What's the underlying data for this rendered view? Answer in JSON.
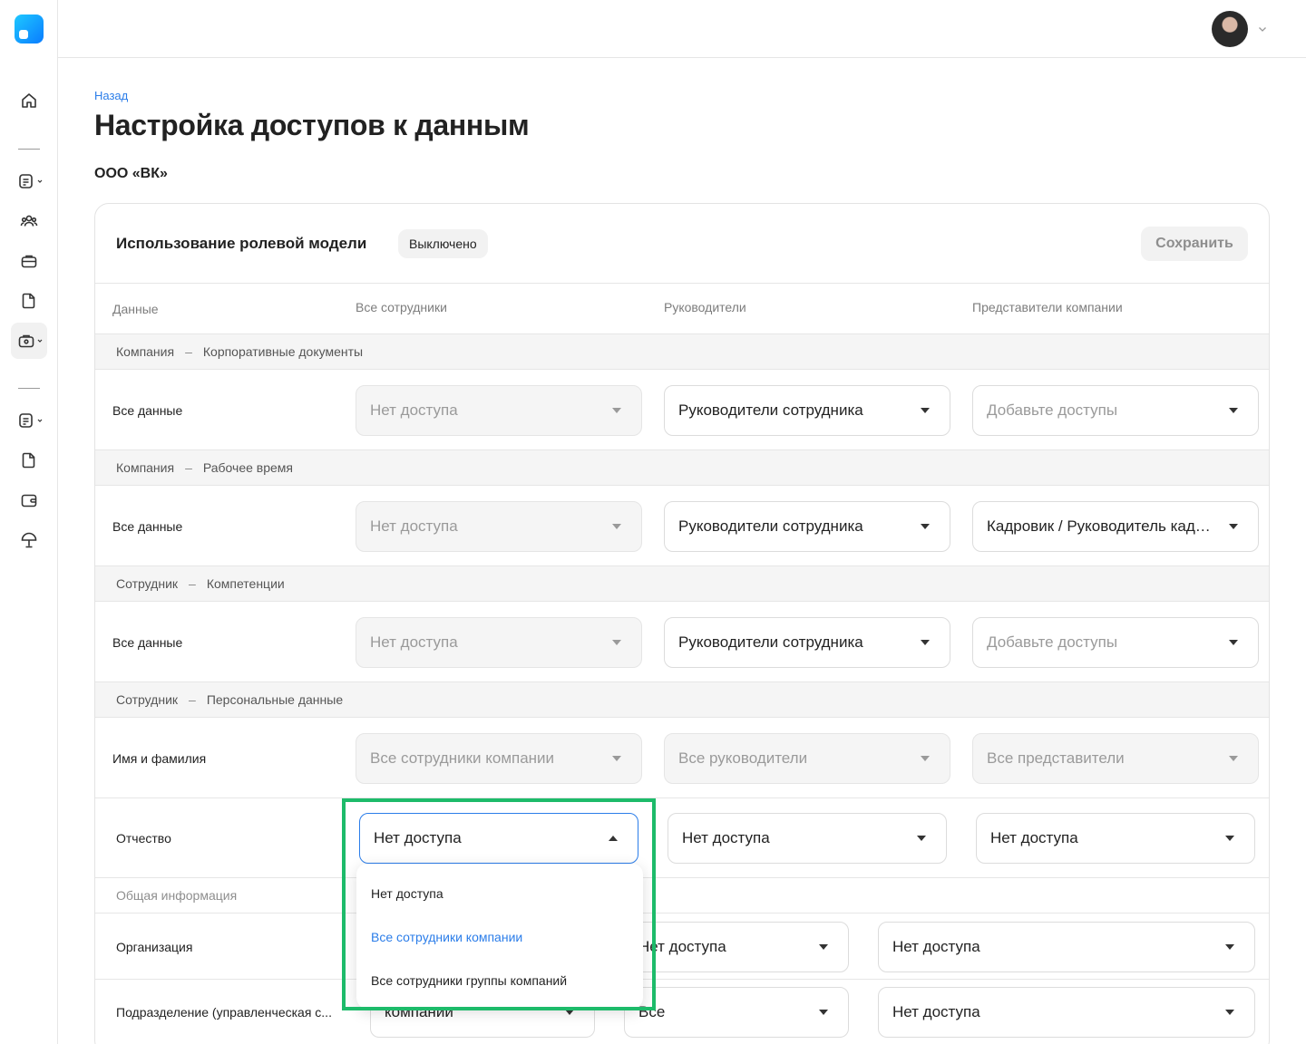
{
  "header": {
    "back_link": "Назад",
    "title": "Настройка доступов к данным",
    "company": "ООО «ВК»"
  },
  "sidebar": {
    "icons": [
      "home-icon",
      "document-list-icon",
      "users-icon",
      "briefcase-icon",
      "file-icon",
      "toolbox-icon",
      "document-list-icon",
      "file-icon",
      "wallet-icon",
      "umbrella-icon"
    ]
  },
  "card": {
    "title": "Использование ролевой модели",
    "status_badge": "Выключено",
    "save_label": "Сохранить",
    "columns": {
      "data": "Данные",
      "all_employees": "Все сотрудники",
      "managers": "Руководители",
      "company_reps": "Представители компании"
    }
  },
  "sections": [
    {
      "entity": "Компания",
      "category": "Корпоративные документы",
      "row": {
        "label": "Все данные",
        "all": "Нет доступа",
        "managers": "Руководители сотрудника",
        "reps": "Добавьте доступы"
      }
    },
    {
      "entity": "Компания",
      "category": "Рабочее время",
      "row": {
        "label": "Все данные",
        "all": "Нет доступа",
        "managers": "Руководители сотрудника",
        "reps": "Кадровик / Руководитель кадров"
      }
    },
    {
      "entity": "Сотрудник",
      "category": "Компетенции",
      "row": {
        "label": "Все данные",
        "all": "Нет доступа",
        "managers": "Руководители сотрудника",
        "reps": "Добавьте доступы"
      }
    },
    {
      "entity": "Сотрудник",
      "category": "Персональные данные",
      "rows": [
        {
          "label": "Имя и фамилия",
          "all": "Все сотрудники компании",
          "managers": "Все руководители",
          "reps": "Все представители"
        },
        {
          "label": "Отчество",
          "all": "Нет доступа",
          "managers": "Нет доступа",
          "reps": "Нет доступа"
        }
      ]
    },
    {
      "entity": "Общая информация",
      "rows": [
        {
          "label": "Организация",
          "managers": "Нет доступа",
          "reps": "Нет доступа"
        },
        {
          "label": "Подразделение (управленческая с...",
          "all": "компании",
          "managers": "Все",
          "reps": "Нет доступа"
        }
      ]
    }
  ],
  "dropdown": {
    "options": [
      "Нет доступа",
      "Все сотрудники компании",
      "Все сотрудники группы компаний"
    ],
    "highlighted_index": 1,
    "highlight_color": "#1dbb6a",
    "accent_color": "#2b7de9"
  }
}
